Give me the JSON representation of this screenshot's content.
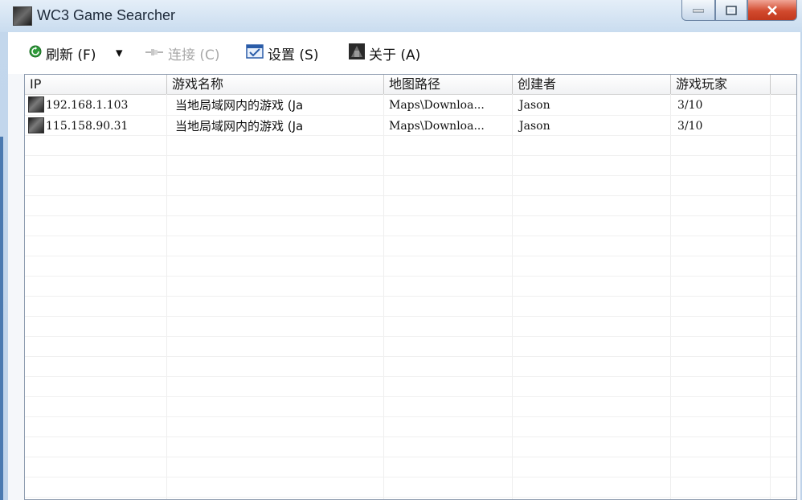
{
  "window": {
    "title": "WC3 Game Searcher"
  },
  "toolbar": {
    "refresh_label": "刷新 (F)",
    "dropdown_label": "▾",
    "connect_label": "连接 (C)",
    "settings_label": "设置 (S)",
    "about_label": "关于 (A)"
  },
  "table": {
    "columns": [
      "IP",
      "游戏名称",
      "地图路径",
      "创建者",
      "游戏玩家"
    ],
    "rows": [
      {
        "ip": "192.168.1.103",
        "game_name": "当地局域网内的游戏 (Ja",
        "map_path": "Maps\\Downloa...",
        "creator": "Jason",
        "players": "3/10"
      },
      {
        "ip": "115.158.90.31",
        "game_name": "当地局域网内的游戏 (Ja",
        "map_path": "Maps\\Downloa...",
        "creator": "Jason",
        "players": "3/10"
      }
    ]
  },
  "colors": {
    "accent": "#4a79b0",
    "close_button": "#d24a2e"
  }
}
